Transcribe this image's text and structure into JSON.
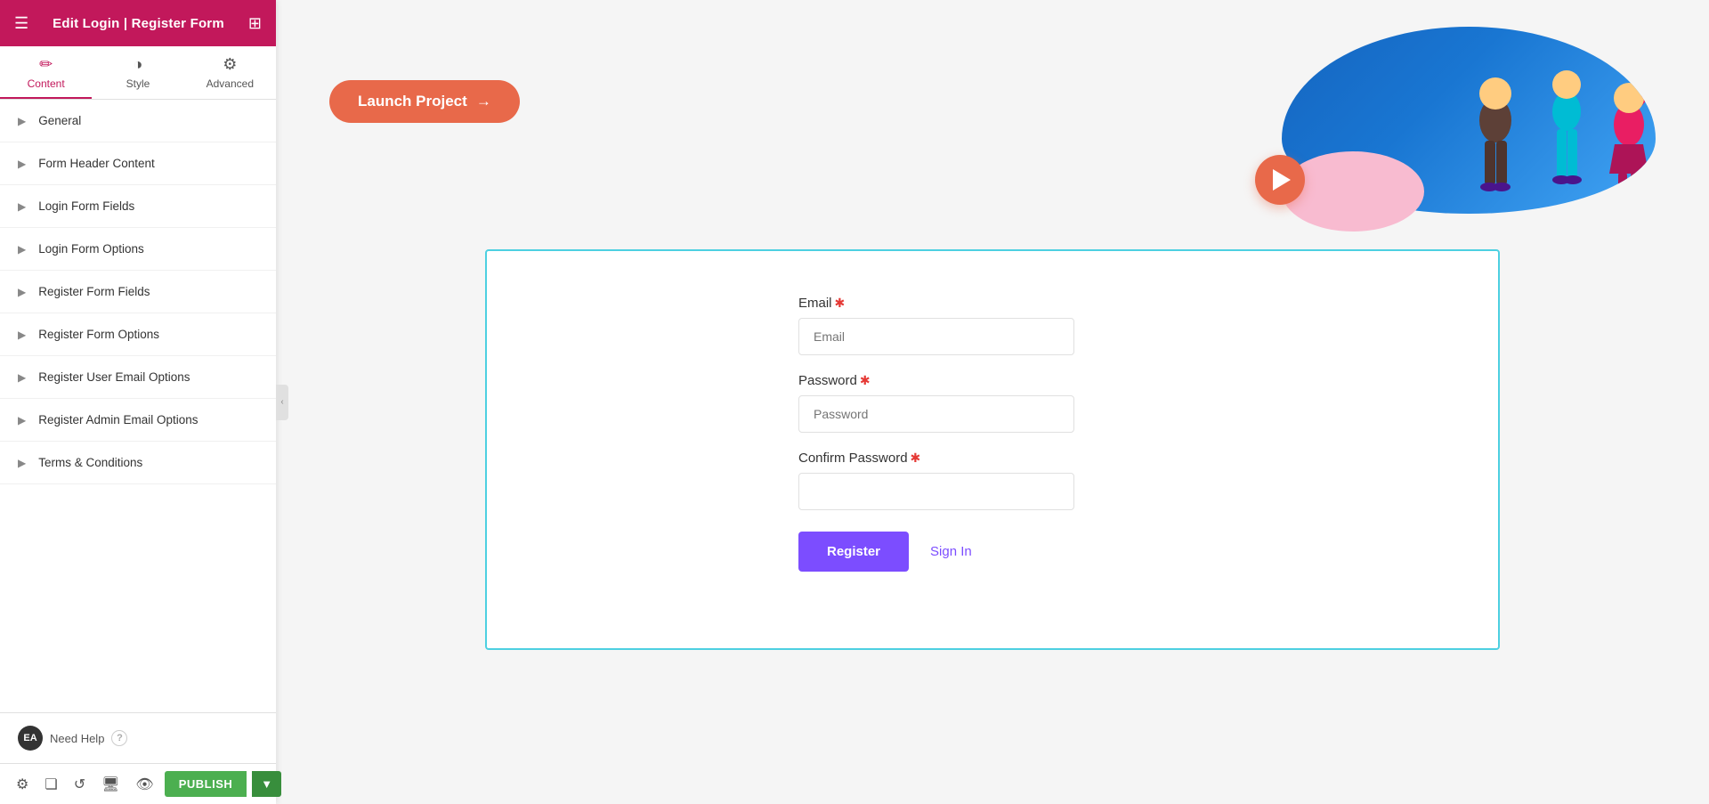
{
  "header": {
    "title": "Edit Login | Register Form",
    "grid_icon": "⊞",
    "menu_icon": "☰"
  },
  "tabs": [
    {
      "id": "content",
      "label": "Content",
      "icon": "✏️",
      "active": true
    },
    {
      "id": "style",
      "label": "Style",
      "icon": "🎨",
      "active": false
    },
    {
      "id": "advanced",
      "label": "Advanced",
      "icon": "⚙️",
      "active": false
    }
  ],
  "sections": [
    {
      "id": "general",
      "label": "General"
    },
    {
      "id": "form-header-content",
      "label": "Form Header Content"
    },
    {
      "id": "login-form-fields",
      "label": "Login Form Fields"
    },
    {
      "id": "login-form-options",
      "label": "Login Form Options"
    },
    {
      "id": "register-form-fields",
      "label": "Register Form Fields"
    },
    {
      "id": "register-form-options",
      "label": "Register Form Options"
    },
    {
      "id": "register-user-email-options",
      "label": "Register User Email Options"
    },
    {
      "id": "register-admin-email-options",
      "label": "Register Admin Email Options"
    },
    {
      "id": "terms-conditions",
      "label": "Terms & Conditions"
    }
  ],
  "footer": {
    "badge": "EA",
    "help_text": "Need Help",
    "help_icon": "?"
  },
  "bottom_bar": {
    "icons": [
      "⚙",
      "❏",
      "↺",
      "🖥",
      "👁"
    ],
    "publish_label": "PUBLISH",
    "publish_arrow": "▼"
  },
  "main": {
    "launch_btn": "Launch Project",
    "launch_arrow": "→",
    "form": {
      "email_label": "Email",
      "email_placeholder": "Email",
      "password_label": "Password",
      "password_placeholder": "Password",
      "confirm_password_label": "Confirm Password",
      "confirm_password_placeholder": "",
      "register_btn": "Register",
      "sign_in_link": "Sign In"
    }
  },
  "colors": {
    "brand_pink": "#c2185b",
    "accent_orange": "#e8694a",
    "accent_purple": "#7c4dff",
    "accent_cyan": "#4dd0e1",
    "publish_green": "#4caf50"
  }
}
